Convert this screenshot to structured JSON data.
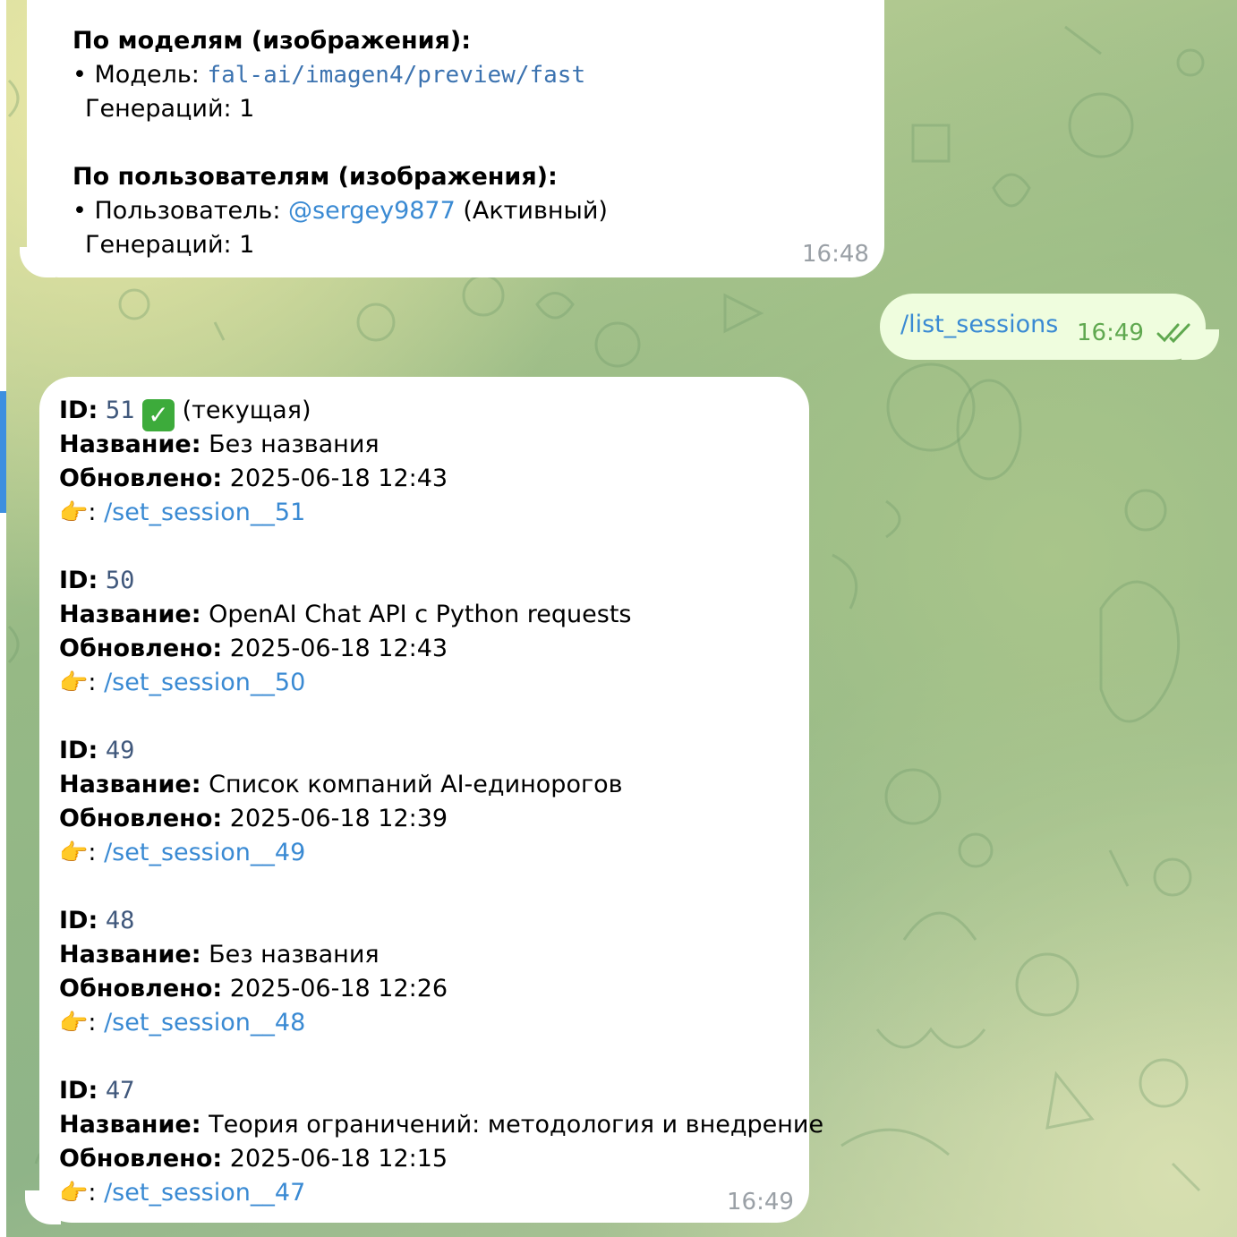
{
  "msg1": {
    "models_header": "По моделям (изображения):",
    "model_prefix": "• Модель: ",
    "model_name": "fal-ai/imagen4/preview/fast",
    "model_gens": "Генераций: 1",
    "users_header": "По пользователям (изображения):",
    "user_prefix": "• Пользователь: ",
    "user_handle": "@sergey9877",
    "user_status": " (Активный)",
    "user_gens": "Генераций: 1",
    "time": "16:48"
  },
  "msg2": {
    "text": "/list_sessions",
    "time": "16:49"
  },
  "msg3": {
    "labels": {
      "id": "ID:",
      "name": "Название:",
      "updated": "Обновлено:",
      "pointer": ":"
    },
    "current_suffix": "(текущая)",
    "sessions": [
      {
        "id": "51",
        "title": "Без названия",
        "updated": "2025-06-18 12:43",
        "command": "/set_session__51"
      },
      {
        "id": "50",
        "title": "OpenAI Chat API с Python requests",
        "updated": "2025-06-18 12:43",
        "command": "/set_session__50"
      },
      {
        "id": "49",
        "title": "Список компаний AI-единорогов",
        "updated": "2025-06-18 12:39",
        "command": "/set_session__49"
      },
      {
        "id": "48",
        "title": "Без названия",
        "updated": "2025-06-18 12:26",
        "command": "/set_session__48"
      },
      {
        "id": "47",
        "title": "Теория ограничений: методология и внедрение",
        "updated": "2025-06-18 12:15",
        "command": "/set_session__47"
      }
    ],
    "time": "16:49"
  },
  "colors": {
    "link": "#3a8ad3",
    "outgoing_bubble": "#effdde",
    "accent": "#3d8fe0"
  }
}
